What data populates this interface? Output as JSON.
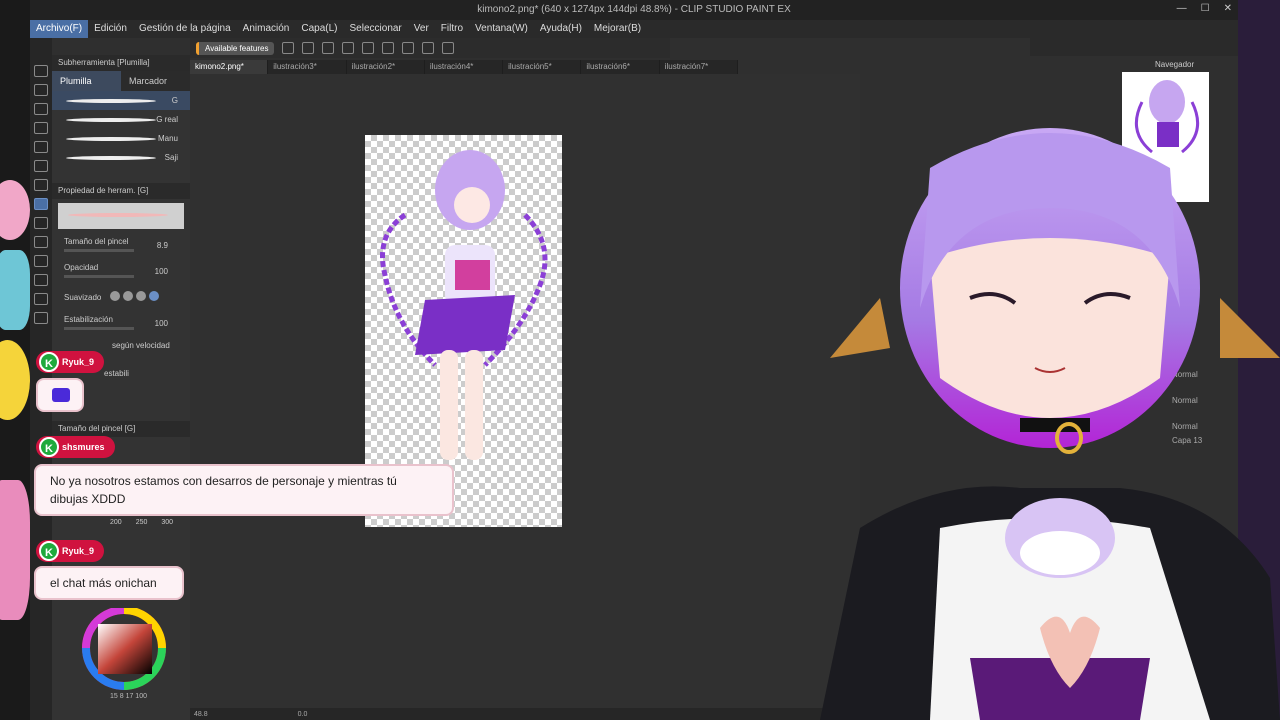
{
  "app": {
    "title": "kimono2.png* (640 x 1274px 144dpi 48.8%) - CLIP STUDIO PAINT EX"
  },
  "menu": [
    "Archivo(F)",
    "Edición",
    "Gestión de la página",
    "Animación",
    "Capa(L)",
    "Seleccionar",
    "Ver",
    "Filtro",
    "Ventana(W)",
    "Ayuda(H)",
    "Mejorar(B)"
  ],
  "toolbar": {
    "available_features": "Available features"
  },
  "subtool": {
    "header": "Subherramienta [Plumilla]",
    "tabs": [
      "Plumilla",
      "Marcador"
    ],
    "brushes": [
      "G",
      "G real",
      "Manu",
      "Saji"
    ]
  },
  "tool_property": {
    "header": "Propiedad de herram. [G]",
    "brush_size_label": "Tamaño del pincel",
    "brush_size_value": "8.9",
    "opacity_label": "Opacidad",
    "opacity_value": "100",
    "smoothing_label": "Suavizado",
    "stabilization_label": "Estabilización",
    "stabilization_value": "100",
    "speed_label": "según velocidad",
    "stab_short": "estabili"
  },
  "brush_size_panel": {
    "header": "Tamaño del pincel [G]",
    "sizes": [
      "200",
      "250",
      "300"
    ]
  },
  "doc_tabs": [
    "kimono2.png*",
    "ilustración3*",
    "ilustración2*",
    "ilustración4*",
    "ilustración5*",
    "ilustración6*",
    "ilustración7*"
  ],
  "status": {
    "zoom": "48.8",
    "angle": "0.0"
  },
  "navigator": {
    "label": "Navegador"
  },
  "layers": [
    "Normal",
    "Normal",
    "Normal",
    "Capa 13"
  ],
  "color_panel": {
    "readout": "15 8 17 100"
  },
  "chat": [
    {
      "user": "Ryuk_9",
      "badge": "K",
      "message": ""
    },
    {
      "user": "shsmures",
      "badge": "K",
      "message": "No ya nosotros estamos con desarros de personaje y mientras tú dibujas XDDD"
    },
    {
      "user": "Ryuk_9",
      "badge": "K",
      "message": "el chat más onichan"
    }
  ],
  "colors": {
    "chat_user_bg": "#d0123f",
    "badge_green": "#1faa3c",
    "accent_blue": "#4a6fa5",
    "hair_purple": "#a47be0"
  }
}
